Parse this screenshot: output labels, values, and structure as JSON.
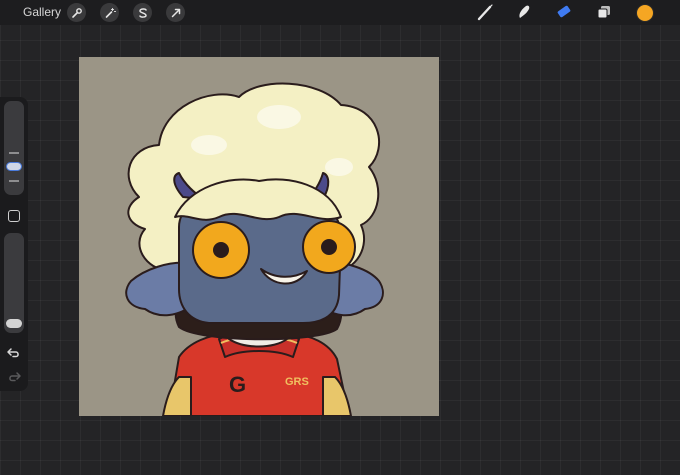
{
  "toolbar": {
    "gallery_label": "Gallery",
    "left_tools": [
      "wrench-icon",
      "magic-wand-icon",
      "selection-s-icon",
      "transform-arrow-icon"
    ],
    "right_tools": [
      "brush-icon",
      "smudge-icon",
      "eraser-icon",
      "layers-icon"
    ],
    "active_tool": "eraser-icon",
    "current_color": "#f5a623",
    "accent_color": "#3f7bf2"
  },
  "sidebar": {
    "brush_size_level": 0.72,
    "opacity_level": 0.95,
    "icons": [
      "square-modifier-icon",
      "undo-icon",
      "redo-icon"
    ]
  },
  "artwork": {
    "canvas_background": "#9b9586",
    "hair_color": "#f4f0c4",
    "skin_color": "#5a6a8a",
    "eye_color": "#f2a81d",
    "jacket_color": "#d8382a",
    "jacket_monogram": "G",
    "jacket_text": "GRS"
  }
}
